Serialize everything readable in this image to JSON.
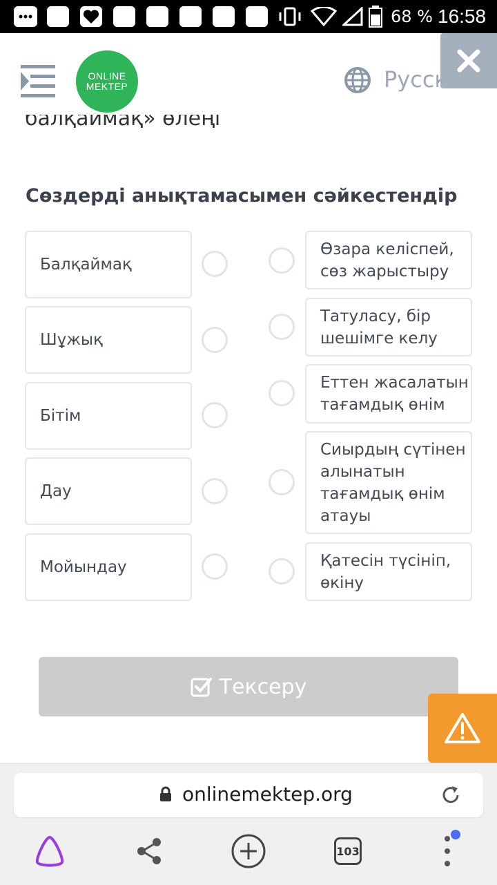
{
  "status_bar": {
    "battery_percent": "68 %",
    "time": "16:58"
  },
  "header": {
    "logo_line1": "ONLINE",
    "logo_line2": "MEKTEP",
    "language": "Русский"
  },
  "content": {
    "previous_title": "балқаймақ» өлеңі",
    "question": "Сөздерді анықтамасымен сәйкестендір",
    "left_items": [
      "Балқаймақ",
      "Шұжық",
      "Бітім",
      "Дау",
      "Мойындау"
    ],
    "right_items": [
      "Өзара келіспей, сөз жарыстыру",
      "Татуласу, бір шешімге келу",
      "Еттен жасалатын тағамдық өнім",
      "Сиырдың сүтінен алынатын тағамдық өнім атауы",
      "Қатесін түсініп, өкіну"
    ],
    "check_button_label": "Тексеру"
  },
  "browser": {
    "url": "onlinemektep.org",
    "tabs_count": "103"
  },
  "colors": {
    "logo_green": "#2fb45a",
    "warning_orange": "#f39a2e",
    "close_gray": "#a5b0bd",
    "disabled_button": "#cccccc",
    "alice_purple": "#9a3fd4",
    "notification_dot": "#4d6df5"
  }
}
